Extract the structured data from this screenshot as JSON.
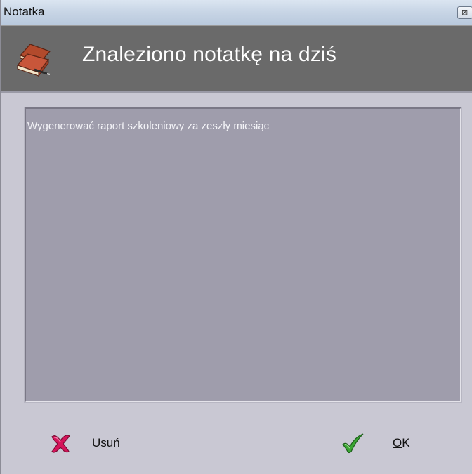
{
  "window": {
    "title": "Notatka",
    "close_glyph": "⊠"
  },
  "header": {
    "title": "Znaleziono notatkę na dziś",
    "icon": "notebook-icon"
  },
  "note": {
    "text": "Wygenerować raport szkoleniowy za zeszły miesiąc"
  },
  "buttons": {
    "delete": {
      "label": "Usuń",
      "icon": "red-x-icon"
    },
    "ok": {
      "label": "OK",
      "icon": "green-check-icon"
    }
  },
  "colors": {
    "header_bg": "#6a6a6a",
    "window_bg": "#c9c8d3",
    "note_bg": "#9f9dac",
    "delete_icon": "#d4145a",
    "ok_icon": "#3aa633"
  }
}
